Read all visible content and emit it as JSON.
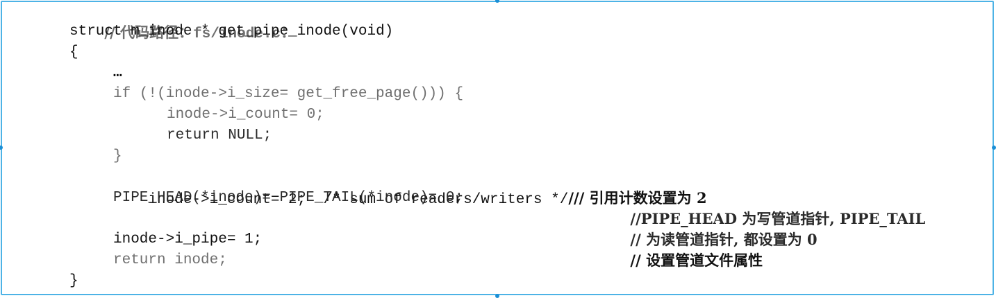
{
  "code": {
    "header_comment_prefix": "// 代码路径：",
    "header_comment_path": "fs/inode.c",
    "header_comment_suffix": "：",
    "func_signature": "struct m_inode * get_pipe_inode(void)",
    "open_brace": "{",
    "ellipsis": "…",
    "if_line": "if (!(inode->i_size= get_free_page())) {",
    "count_zero": "inode->i_count= 0;",
    "return_null": "return NULL;",
    "inner_close_brace": "}",
    "count_two_code": "inode->i_count= 2;  /* sum of readers/writers */",
    "count_two_comment": "/// 引用计数设置为 2",
    "pipe_head_code": "PIPE_HEAD(*inode)= PIPE_TAIL(*inode)= 0;",
    "pipe_head_comment": "//PIPE_HEAD 为写管道指针, PIPE_TAIL",
    "pipe_head_comment_cont": "// 为读管道指针, 都设置为 0",
    "i_pipe_code": "inode->i_pipe= 1;",
    "i_pipe_comment": "// 设置管道文件属性",
    "return_inode": "return inode;",
    "close_brace": "}"
  }
}
